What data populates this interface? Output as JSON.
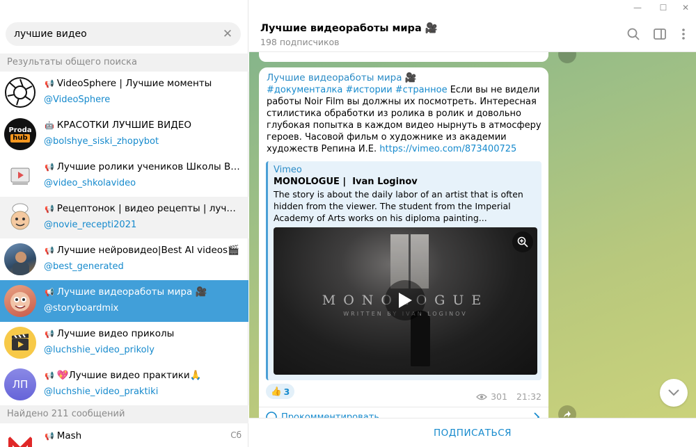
{
  "colors": {
    "accent": "#419fd9",
    "link": "#168acd",
    "selected_bg": "#419fd9"
  },
  "search": {
    "value": "лучшие видео",
    "placeholder": ""
  },
  "sections": {
    "global": "Результаты общего поиска",
    "messages": "Найдено 211 сообщений"
  },
  "results": [
    {
      "title": "VideoSphere | Лучшие моменты",
      "handle": "@VideoSphere",
      "icon": "megaphone-icon"
    },
    {
      "title": "КРАСОТКИ ЛУЧШИЕ ВИДЕО",
      "handle": "@bolshye_siski_zhopybot",
      "icon": "bot-icon",
      "avatar_text": "Proda hub"
    },
    {
      "title": "Лучшие ролики учеников Школы Видео",
      "handle": "@video_shkolavideo",
      "icon": "megaphone-icon"
    },
    {
      "title": "Рецептонок | видео рецепты | лучшие ...",
      "handle": "@novie_recepti2021",
      "icon": "megaphone-icon"
    },
    {
      "title": "Лучшие нейровидео|Best AI videos🎬",
      "handle": "@best_generated",
      "icon": "megaphone-icon"
    },
    {
      "title": "Лучшие видеоработы мира 🎥",
      "handle": "@storyboardmix",
      "icon": "megaphone-icon"
    },
    {
      "title": "Лучшие видео приколы",
      "handle": "@luchshie_video_prikoly",
      "icon": "megaphone-icon"
    },
    {
      "title": "💖Лучшие видео практики🙏",
      "handle": "@luchshie_video_praktiki",
      "icon": "megaphone-icon",
      "avatar_text": "ЛП"
    }
  ],
  "message_results": [
    {
      "title": "Mash",
      "date": "Сб",
      "icon": "megaphone-icon"
    }
  ],
  "chat": {
    "title": "Лучшие видеоработы мира 🎥",
    "subtitle": "198 подписчиков"
  },
  "post": {
    "author": "Лучшие видеоработы мира 🎥",
    "hashtags": "#документалка #истории #странное",
    "text": " Если вы не видели работы Noir Film вы должны их посмотреть. Интересная стилистика обработки из ролика в ролик и довольно глубокая попытка в каждом видео нырнуть в атмосферу героев. Часовой фильм о художнике из академии художеств Репина И.Е. ",
    "link": "https://vimeo.com/873400725",
    "preview": {
      "site": "Vimeo",
      "title": "MONOLOGUE |  Ivan Loginov",
      "description": "The story is about the daily labor of an artist that is often hidden from the viewer.  The student from the Imperial Academy of Arts works on his diploma painting...",
      "video_title": "MONOLOGUE",
      "video_sub": "WRITTEN BY IVAN LOGINOV"
    },
    "reaction_emoji": "👍",
    "reaction_count": "3",
    "views": "301",
    "time": "21:32",
    "comment_label": "Прокомментировать"
  },
  "footer": {
    "subscribe_label": "ПОДПИСАТЬСЯ"
  }
}
